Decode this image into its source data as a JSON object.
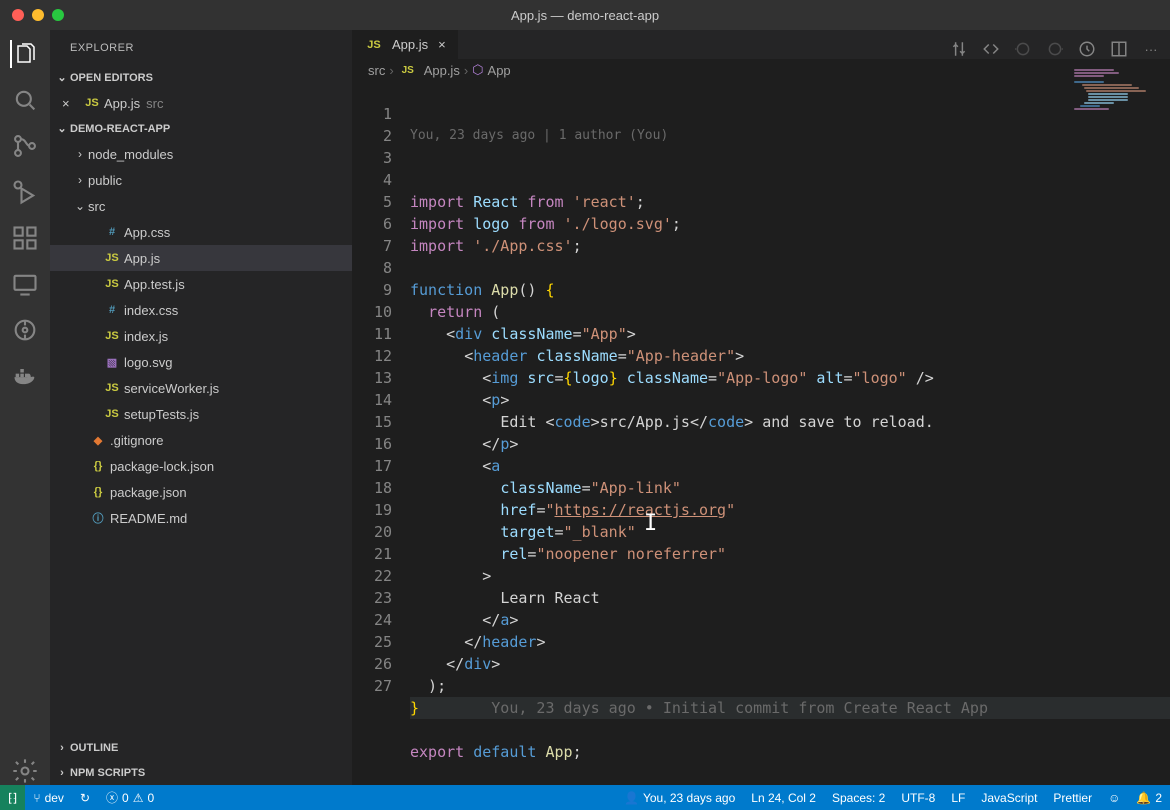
{
  "title": "App.js — demo-react-app",
  "sidebar": {
    "title": "EXPLORER",
    "openEditors": {
      "label": "OPEN EDITORS",
      "items": [
        {
          "name": "App.js",
          "location": "src",
          "icon": "js"
        }
      ]
    },
    "project": {
      "label": "DEMO-REACT-APP",
      "tree": [
        {
          "d": 1,
          "type": "folder",
          "open": false,
          "name": "node_modules"
        },
        {
          "d": 1,
          "type": "folder",
          "open": false,
          "name": "public"
        },
        {
          "d": 1,
          "type": "folder",
          "open": true,
          "name": "src"
        },
        {
          "d": 2,
          "type": "file",
          "icon": "css",
          "sym": "#",
          "name": "App.css"
        },
        {
          "d": 2,
          "type": "file",
          "icon": "js",
          "sym": "JS",
          "name": "App.js",
          "selected": true
        },
        {
          "d": 2,
          "type": "file",
          "icon": "js",
          "sym": "JS",
          "name": "App.test.js"
        },
        {
          "d": 2,
          "type": "file",
          "icon": "css",
          "sym": "#",
          "name": "index.css"
        },
        {
          "d": 2,
          "type": "file",
          "icon": "js",
          "sym": "JS",
          "name": "index.js"
        },
        {
          "d": 2,
          "type": "file",
          "icon": "svg",
          "sym": "▧",
          "name": "logo.svg"
        },
        {
          "d": 2,
          "type": "file",
          "icon": "js",
          "sym": "JS",
          "name": "serviceWorker.js"
        },
        {
          "d": 2,
          "type": "file",
          "icon": "js",
          "sym": "JS",
          "name": "setupTests.js"
        },
        {
          "d": 1,
          "type": "file",
          "icon": "git",
          "sym": "◆",
          "name": ".gitignore"
        },
        {
          "d": 1,
          "type": "file",
          "icon": "json",
          "sym": "{}",
          "name": "package-lock.json"
        },
        {
          "d": 1,
          "type": "file",
          "icon": "json",
          "sym": "{}",
          "name": "package.json"
        },
        {
          "d": 1,
          "type": "file",
          "icon": "info",
          "sym": "ⓘ",
          "name": "README.md"
        }
      ]
    },
    "outline": "OUTLINE",
    "npm": "NPM SCRIPTS"
  },
  "tabs": [
    {
      "name": "App.js",
      "icon": "js"
    }
  ],
  "breadcrumbs": [
    "src",
    "App.js",
    "App"
  ],
  "gitlens_top": "You, 23 days ago | 1 author (You)",
  "code": {
    "lines": [
      {
        "n": 1,
        "html": "<span class='k-import'>import</span> <span class='s-id'>React</span> <span class='k-from'>from</span> <span class='s-str'>'react'</span>;"
      },
      {
        "n": 2,
        "html": "<span class='k-import'>import</span> <span class='s-id'>logo</span> <span class='k-from'>from</span> <span class='s-str'>'./logo.svg'</span>;"
      },
      {
        "n": 3,
        "html": "<span class='k-import'>import</span> <span class='s-str'>'./App.css'</span>;"
      },
      {
        "n": 4,
        "html": ""
      },
      {
        "n": 5,
        "html": "<span class='k-func'>function</span> <span class='s-fn'>App</span>() <span class='s-brace'>{</span>"
      },
      {
        "n": 6,
        "html": "  <span class='k-return'>return</span> ("
      },
      {
        "n": 7,
        "html": "    <span class='s-br'>&lt;</span><span class='s-tag'>div</span> <span class='s-attr'>className</span>=<span class='s-str'>\"App\"</span><span class='s-br'>&gt;</span>"
      },
      {
        "n": 8,
        "html": "      <span class='s-br'>&lt;</span><span class='s-tag'>header</span> <span class='s-attr'>className</span>=<span class='s-str'>\"App-header\"</span><span class='s-br'>&gt;</span>"
      },
      {
        "n": 9,
        "html": "        <span class='s-br'>&lt;</span><span class='s-tag'>img</span> <span class='s-attr'>src</span>=<span class='s-brace'>{</span><span class='s-id'>logo</span><span class='s-brace'>}</span> <span class='s-attr'>className</span>=<span class='s-str'>\"App-logo\"</span> <span class='s-attr'>alt</span>=<span class='s-str'>\"logo\"</span> <span class='s-br'>/&gt;</span>"
      },
      {
        "n": 10,
        "html": "        <span class='s-br'>&lt;</span><span class='s-tag'>p</span><span class='s-br'>&gt;</span>"
      },
      {
        "n": 11,
        "html": "          <span class='s-txt'>Edit </span><span class='s-br'>&lt;</span><span class='s-tag'>code</span><span class='s-br'>&gt;</span><span class='s-txt'>src/App.js</span><span class='s-br'>&lt;/</span><span class='s-tag'>code</span><span class='s-br'>&gt;</span><span class='s-txt'> and save to reload.</span>"
      },
      {
        "n": 12,
        "html": "        <span class='s-br'>&lt;/</span><span class='s-tag'>p</span><span class='s-br'>&gt;</span>"
      },
      {
        "n": 13,
        "html": "        <span class='s-br'>&lt;</span><span class='s-tag'>a</span>"
      },
      {
        "n": 14,
        "html": "          <span class='s-attr'>className</span>=<span class='s-str'>\"App-link\"</span>"
      },
      {
        "n": 15,
        "html": "          <span class='s-attr'>href</span>=<span class='s-str'>\"</span><span class='s-link'>https://reactjs.org</span><span class='s-str'>\"</span>"
      },
      {
        "n": 16,
        "html": "          <span class='s-attr'>target</span>=<span class='s-str'>\"_blank\"</span>"
      },
      {
        "n": 17,
        "html": "          <span class='s-attr'>rel</span>=<span class='s-str'>\"noopener noreferrer\"</span>"
      },
      {
        "n": 18,
        "html": "        <span class='s-br'>&gt;</span>"
      },
      {
        "n": 19,
        "html": "          <span class='s-txt'>Learn React</span>"
      },
      {
        "n": 20,
        "html": "        <span class='s-br'>&lt;/</span><span class='s-tag'>a</span><span class='s-br'>&gt;</span>"
      },
      {
        "n": 21,
        "html": "      <span class='s-br'>&lt;/</span><span class='s-tag'>header</span><span class='s-br'>&gt;</span>"
      },
      {
        "n": 22,
        "html": "    <span class='s-br'>&lt;/</span><span class='s-tag'>div</span><span class='s-br'>&gt;</span>"
      },
      {
        "n": 23,
        "html": "  );"
      },
      {
        "n": 24,
        "html": "<span class='s-brace'>}</span>        <span class='gitlens-inline'>You, 23 days ago • Initial commit from Create React App</span>",
        "hl": true
      },
      {
        "n": 25,
        "html": ""
      },
      {
        "n": 26,
        "html": "<span class='k-export'>export</span> <span class='k-def'>default</span> <span class='s-fn'>App</span>;"
      },
      {
        "n": 27,
        "html": ""
      }
    ]
  },
  "statusbar": {
    "remoteIcon": "⟩⟨",
    "branch": "dev",
    "sync": "↻",
    "errors": "0",
    "warnings": "0",
    "gitlens": "You, 23 days ago",
    "cursor": "Ln 24, Col 2",
    "spaces": "Spaces: 2",
    "encoding": "UTF-8",
    "eol": "LF",
    "lang": "JavaScript",
    "prettier": "Prettier",
    "feedback": "☺",
    "bell": "2"
  }
}
